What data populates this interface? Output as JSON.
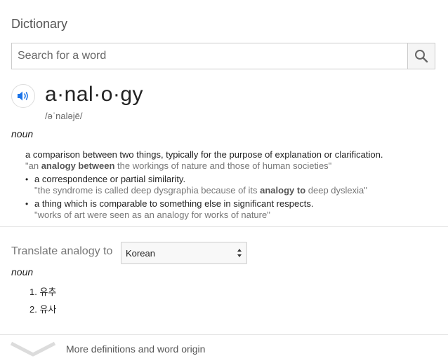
{
  "header": {
    "title": "Dictionary"
  },
  "search": {
    "placeholder": "Search for a word"
  },
  "entry": {
    "word": "a·nal·o·gy",
    "phonetic": "/əˈnaləjē/",
    "part_of_speech": "noun",
    "definitions": [
      {
        "text": "a comparison between two things, typically for the purpose of explanation or clarification.",
        "example": [
          "\"an ",
          "analogy between",
          " the workings of nature and those of human societies\""
        ]
      },
      {
        "text": "a correspondence or partial similarity.",
        "example": [
          "\"the syndrome is called deep dysgraphia because of its ",
          "analogy to",
          " deep dyslexia\""
        ]
      },
      {
        "text": "a thing which is comparable to something else in significant respects.",
        "example": [
          "\"works of art were seen as an analogy for works of nature\""
        ]
      }
    ]
  },
  "translate": {
    "label": "Translate analogy to",
    "selected_language": "Korean",
    "part_of_speech": "noun",
    "items": [
      "1.  유추",
      "2.  유사"
    ]
  },
  "footer": {
    "more_label": "More definitions and word origin"
  },
  "colors": {
    "accent": "#1a73e8",
    "text": "#222222",
    "muted": "#777777"
  }
}
